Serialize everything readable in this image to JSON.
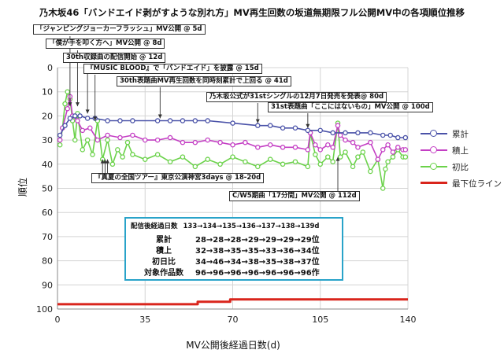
{
  "chart_data": {
    "type": "line",
    "title": "乃木坂46「バンドエイド剥がすような別れ方」MV再生回数の坂道無期限フル公開MV中の各項順位推移",
    "xlabel": "MV公開後経過日数(d)",
    "ylabel": "順位",
    "xlim": [
      0,
      140
    ],
    "ylim": [
      100,
      0
    ],
    "y_inverted": true,
    "x_ticks": [
      "0",
      "35",
      "70",
      "105",
      "140"
    ],
    "y_ticks": [
      "0",
      "10",
      "20",
      "30",
      "40",
      "50",
      "60",
      "70",
      "80",
      "90",
      "100"
    ],
    "grid": true,
    "legend_position": "right",
    "series": [
      {
        "name": "累計",
        "color": "#4a52a8",
        "marker": "circle-open",
        "x": [
          1,
          3,
          5,
          7,
          9,
          12,
          15,
          20,
          25,
          30,
          40,
          45,
          50,
          55,
          60,
          70,
          80,
          85,
          90,
          95,
          100,
          105,
          110,
          115,
          120,
          125,
          130,
          133,
          136,
          139
        ],
        "y": [
          28,
          24,
          21,
          20,
          20,
          21,
          21,
          22,
          22,
          22,
          22,
          22,
          22,
          22,
          22,
          23,
          24,
          24,
          25,
          25,
          26,
          26,
          27,
          27,
          27,
          27,
          28,
          28,
          29,
          29
        ]
      },
      {
        "name": "積上",
        "color": "#c43fc4",
        "marker": "circle-open",
        "x": [
          1,
          2,
          4,
          5,
          6,
          8,
          10,
          13,
          16,
          20,
          25,
          30,
          35,
          40,
          45,
          50,
          55,
          60,
          65,
          70,
          75,
          80,
          85,
          90,
          95,
          100,
          101,
          103,
          105,
          108,
          110,
          112,
          113,
          115,
          118,
          120,
          125,
          128,
          130,
          132,
          134,
          136,
          138,
          139
        ],
        "y": [
          30,
          25,
          17,
          12,
          20,
          22,
          26,
          25,
          30,
          28,
          29,
          28,
          30,
          30,
          29,
          31,
          31,
          30,
          31,
          32,
          31,
          33,
          32,
          33,
          33,
          34,
          27,
          32,
          34,
          32,
          33,
          24,
          28,
          30,
          31,
          33,
          31,
          38,
          34,
          32,
          35,
          33,
          34,
          34
        ]
      },
      {
        "name": "初比",
        "color": "#6bd24a",
        "marker": "circle-open",
        "x": [
          1,
          2,
          3,
          4,
          5,
          6,
          7,
          8,
          10,
          12,
          14,
          16,
          18,
          20,
          22,
          24,
          26,
          28,
          30,
          35,
          40,
          45,
          50,
          55,
          60,
          65,
          70,
          75,
          80,
          85,
          90,
          95,
          100,
          101,
          103,
          105,
          108,
          110,
          112,
          113,
          115,
          118,
          120,
          122,
          125,
          128,
          130,
          131,
          132,
          134,
          136,
          138,
          139
        ],
        "y": [
          32,
          25,
          15,
          10,
          13,
          22,
          30,
          19,
          34,
          30,
          36,
          22,
          38,
          30,
          40,
          34,
          37,
          31,
          36,
          38,
          36,
          39,
          37,
          41,
          38,
          40,
          37,
          39,
          41,
          38,
          40,
          39,
          41,
          27,
          36,
          40,
          37,
          39,
          23,
          37,
          35,
          41,
          37,
          35,
          43,
          38,
          50,
          42,
          39,
          37,
          34,
          37,
          37
        ]
      },
      {
        "name": "最下位ライン",
        "color": "#d9251c",
        "marker": "none",
        "x": [
          0,
          56,
          56,
          69,
          69,
          140
        ],
        "y": [
          98,
          98,
          97,
          97,
          96,
          96
        ]
      }
    ],
    "annotations": [
      "「ジャンピングジョーカーフラッシュ」MV公開 @ 5d",
      "「僕が手を叩く方へ」MV公開 @ 8d",
      "30th収録曲の配信開始 @ 12d",
      "『MUSIC BLOOD』で「バンドエイド」を披露 @ 15d",
      "30th表題曲MV再生回数を同時刻累計で上回る @ 41d",
      "乃木坂公式が31stシングルの12月7日発売を発表@ 80d",
      "31st表題曲「ここにはないもの」MV公開 @ 100d",
      "『真夏の全国ツアー』東京公演神宮3days @ 18-20d",
      "C/W5期曲「17分間」MV公開 @ 112d"
    ],
    "stats_table": {
      "header_label": "配信後経過日数",
      "header_values": "133→134→135→136→137→138→139d",
      "rows": [
        {
          "label": "累計",
          "values": "28→28→28→29→29→29→29位"
        },
        {
          "label": "積上",
          "values": "32→38→35→35→33→36→34位"
        },
        {
          "label": "初日比",
          "values": "34→46→34→38→35→38→37位"
        },
        {
          "label": "対象作品数",
          "values": "96→96→96→96→96→96→96作"
        }
      ]
    }
  }
}
